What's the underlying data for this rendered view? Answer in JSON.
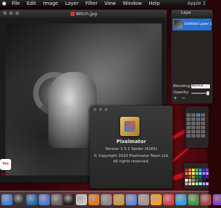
{
  "menubar": {
    "apple": "",
    "items": [
      "File",
      "Edit",
      "Image",
      "Layer",
      "Filter",
      "View",
      "Window",
      "Help"
    ],
    "status_right": "Apple 1"
  },
  "main_window": {
    "title": "Witch.jpg"
  },
  "about_box": {
    "app_name": "Pixelmator",
    "version": "Version 1.5.1 Spider (4265)",
    "copyright": "© Copyright 2010 Pixelmator Team Ltd.",
    "rights": "All rights reserved."
  },
  "layers_panel": {
    "title": "Laye",
    "layer_name": "Untitled Layer 1",
    "blending_label": "Blending:",
    "blending_value": "Normal",
    "opacity_label": "Opacity:",
    "opacity_level_percent": 100,
    "add_label": "+",
    "remove_label": "−"
  },
  "colors": {
    "accent": "#2b6fd6",
    "menubar_bg": "#1a1a1a",
    "desktop_red": "#d0101e"
  },
  "dock": {
    "items": [
      {
        "name": "finder-icon",
        "color": "#3b82d6"
      },
      {
        "name": "dashboard-icon",
        "color": "#333"
      },
      {
        "name": "globe-icon",
        "color": "#1f6fb2"
      },
      {
        "name": "itunes-icon",
        "color": "#4a7ad8"
      },
      {
        "name": "speaker-icon",
        "color": "#666"
      },
      {
        "name": "ball-icon",
        "color": "#222"
      },
      {
        "name": "clock-icon",
        "color": "#c8c8c8"
      },
      {
        "name": "vlc-icon",
        "color": "#e07a10"
      },
      {
        "name": "trash-icon",
        "color": "#888"
      },
      {
        "name": "pixelmator-icon",
        "color": "#c89a3a"
      },
      {
        "name": "folder-icon",
        "color": "#5a8ad8"
      },
      {
        "name": "camera-icon",
        "color": "#999"
      },
      {
        "name": "wifi-icon",
        "color": "#f0a020"
      },
      {
        "name": "sync-icon",
        "color": "#d84040"
      },
      {
        "name": "skype-icon",
        "color": "#2aa0e0"
      },
      {
        "name": "chrome-icon",
        "color": "#3c9a3c"
      },
      {
        "name": "photos-icon",
        "color": "#aa4444"
      },
      {
        "name": "music-icon",
        "color": "#7a3cc8"
      }
    ]
  },
  "side_icons": {
    "youtube_label": "You Tube"
  }
}
